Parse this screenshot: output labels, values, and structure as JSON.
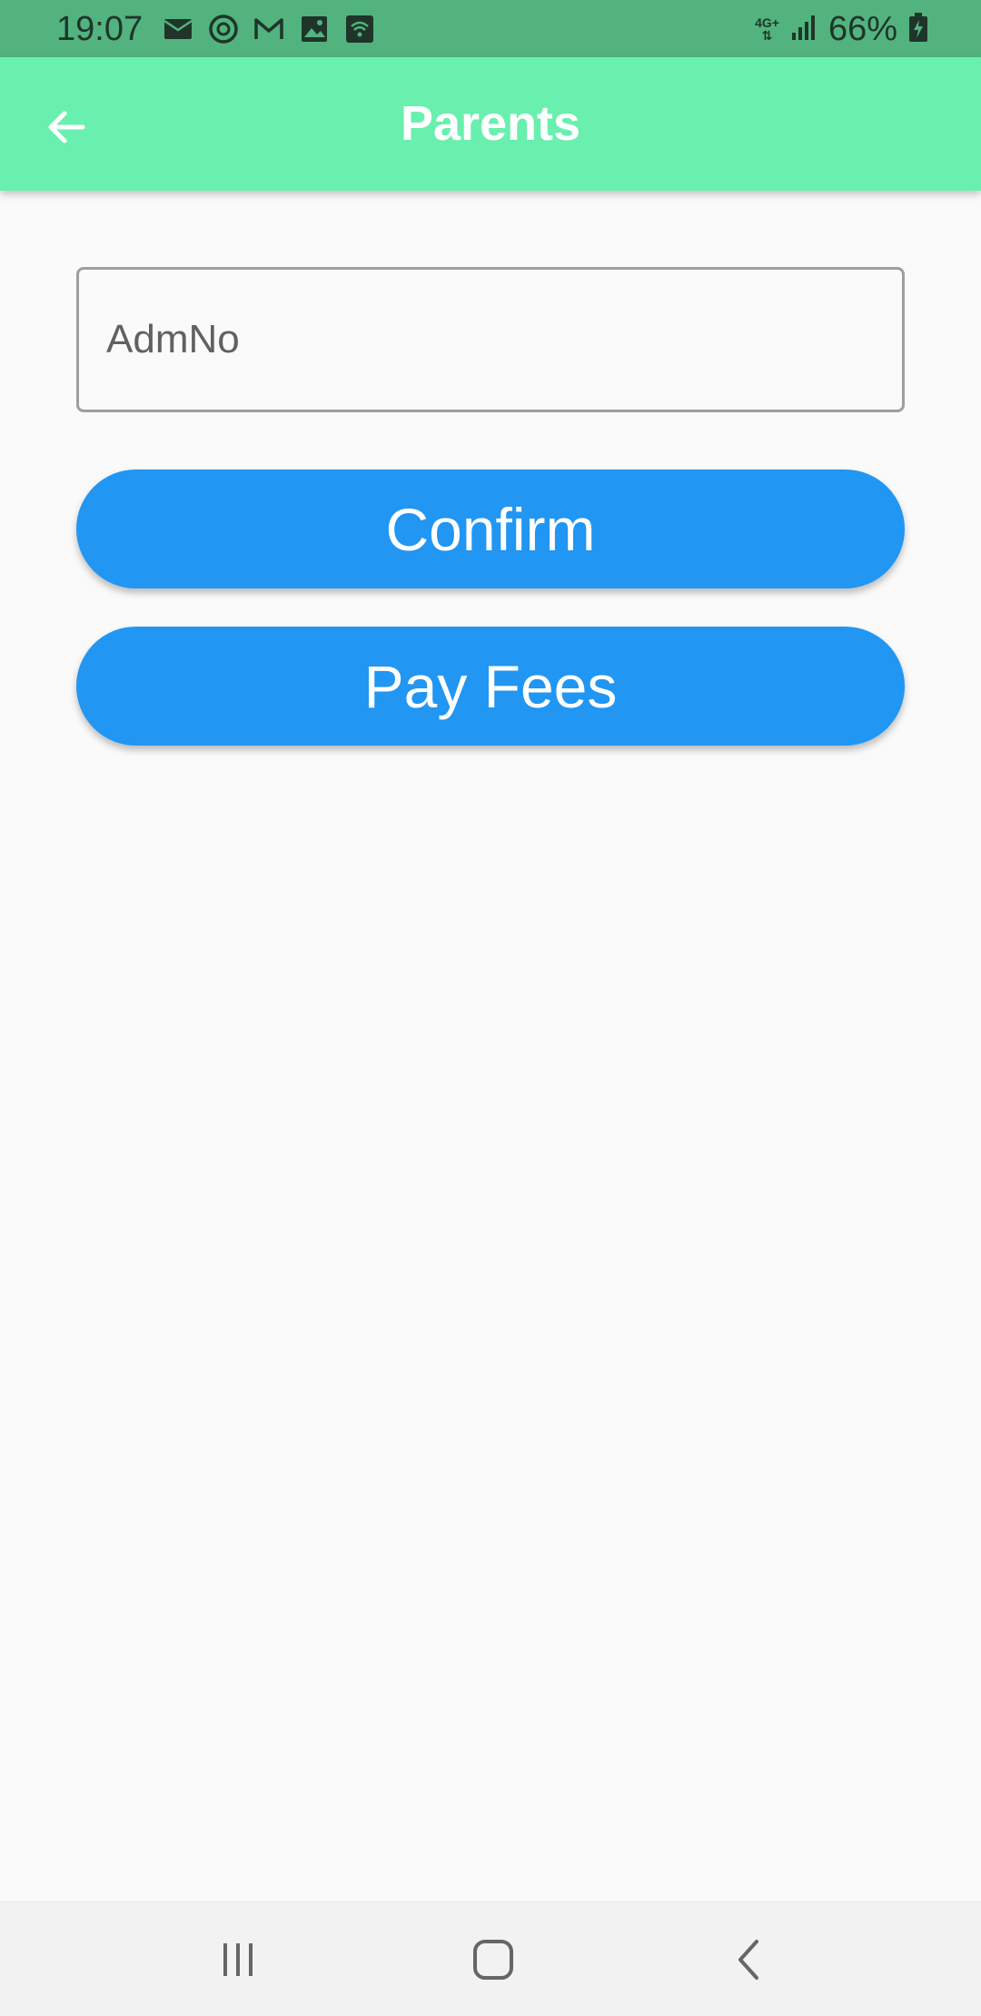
{
  "status_bar": {
    "time": "19:07",
    "network": "4G+",
    "battery": "66%",
    "icons": [
      "email-icon",
      "threads-icon",
      "gmail-icon",
      "gallery-icon",
      "wifi-app-icon",
      "signal-icon",
      "battery-charging-icon"
    ]
  },
  "app_bar": {
    "title": "Parents",
    "back_icon": "arrow-left-icon"
  },
  "form": {
    "admno_placeholder": "AdmNo",
    "admno_value": ""
  },
  "buttons": {
    "confirm": "Confirm",
    "pay_fees": "Pay Fees"
  },
  "nav_bar": {
    "icons": [
      "recents-icon",
      "home-icon",
      "back-icon"
    ]
  },
  "colors": {
    "status_bar": "#52b37f",
    "app_bar": "#69f0ae",
    "button": "#2196f3",
    "background": "#fafafa"
  }
}
